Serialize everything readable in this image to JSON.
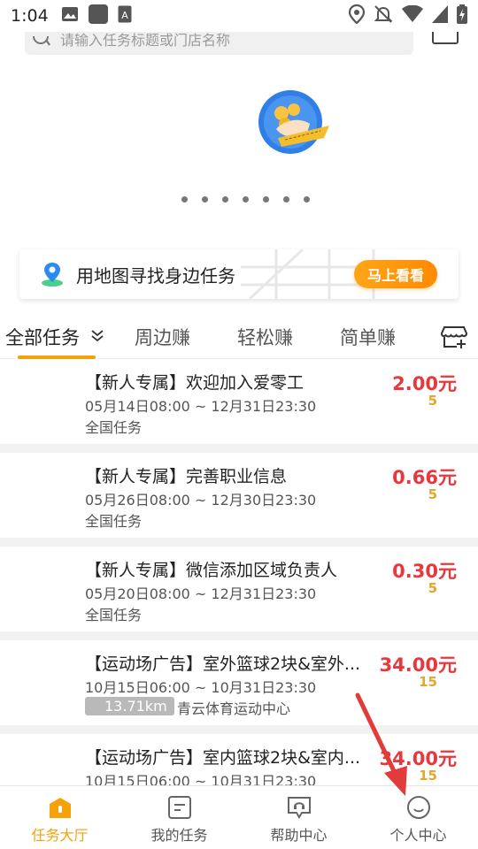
{
  "status_bar": {
    "time": "1:04",
    "left_icons": [
      "image-icon",
      "square-icon",
      "font-icon"
    ],
    "right_icons": [
      "location-icon",
      "mute-icon",
      "wifi-icon",
      "signal-icon",
      "battery-icon"
    ]
  },
  "search": {
    "placeholder": "请输入任务标题或门店名称"
  },
  "banner": {
    "dots_count": 7
  },
  "map_card": {
    "text": "用地图寻找身边任务",
    "button": "马上看看"
  },
  "tabs": [
    {
      "label": "全部任务",
      "active": true
    },
    {
      "label": "周边赚",
      "active": false
    },
    {
      "label": "轻松赚",
      "active": false
    },
    {
      "label": "简单赚",
      "active": false
    }
  ],
  "tasks": [
    {
      "title": "【新人专属】欢迎加入爱零工",
      "date": "05月14日08:00 ~ 12月31日23:30",
      "area": "全国任务",
      "price": "2.00元",
      "count": "5"
    },
    {
      "title": "【新人专属】完善职业信息",
      "date": "05月26日08:00 ~ 12月30日23:30",
      "area": "全国任务",
      "price": "0.66元",
      "count": "5"
    },
    {
      "title": "【新人专属】微信添加区域负责人",
      "date": "05月20日08:00 ~ 12月31日23:30",
      "area": "全国任务",
      "price": "0.30元",
      "count": "5"
    },
    {
      "title": "【运动场广告】室外篮球2块&室外...",
      "date": "10月15日06:00 ~ 10月31日23:30",
      "distance": "13.71km",
      "venue": "青云体育运动中心",
      "price": "34.00元",
      "count": "15"
    },
    {
      "title": "【运动场广告】室内篮球2块&室内...",
      "date": "10月15日06:00 ~ 10月31日23:30",
      "price": "34.00元",
      "count": "15"
    }
  ],
  "bottom_nav": [
    {
      "label": "任务大厅",
      "icon": "home-icon",
      "active": true
    },
    {
      "label": "我的任务",
      "icon": "task-list-icon",
      "active": false
    },
    {
      "label": "帮助中心",
      "icon": "help-chat-icon",
      "active": false
    },
    {
      "label": "个人中心",
      "icon": "profile-icon",
      "active": false
    }
  ],
  "colors": {
    "accent": "#f5a20a",
    "price": "#e8383d",
    "count": "#e5a62c",
    "annotation_arrow": "#e23b3b"
  }
}
